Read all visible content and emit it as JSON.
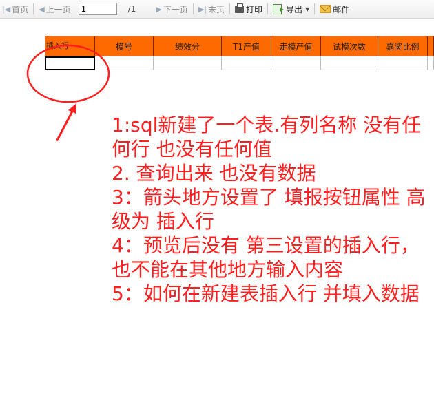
{
  "toolbar": {
    "first": "首页",
    "prev": "上一页",
    "page_value": "1",
    "page_total": "/1",
    "next": "下一页",
    "last": "末页",
    "print": "打印",
    "export": "导出",
    "mail": "邮件"
  },
  "table": {
    "columns": [
      "插入行",
      "模号",
      "绩效分",
      "T1产值",
      "走模产值",
      "试模次数",
      "嘉奖比例",
      ""
    ],
    "header_color": "#ff6a00"
  },
  "annotation": {
    "color": "#ff1f1f",
    "lines": [
      "1:sql新建了一个表.有列名称 没有任何行 也没有任何值",
      "2. 查询出来 也没有数据",
      "3：箭头地方设置了 填报按钮属性 高级为 插入行",
      "4：预览后没有 第三设置的插入行， 也不能在其他地方输入内容",
      "5：如何在新建表插入行 并填入数据"
    ]
  }
}
